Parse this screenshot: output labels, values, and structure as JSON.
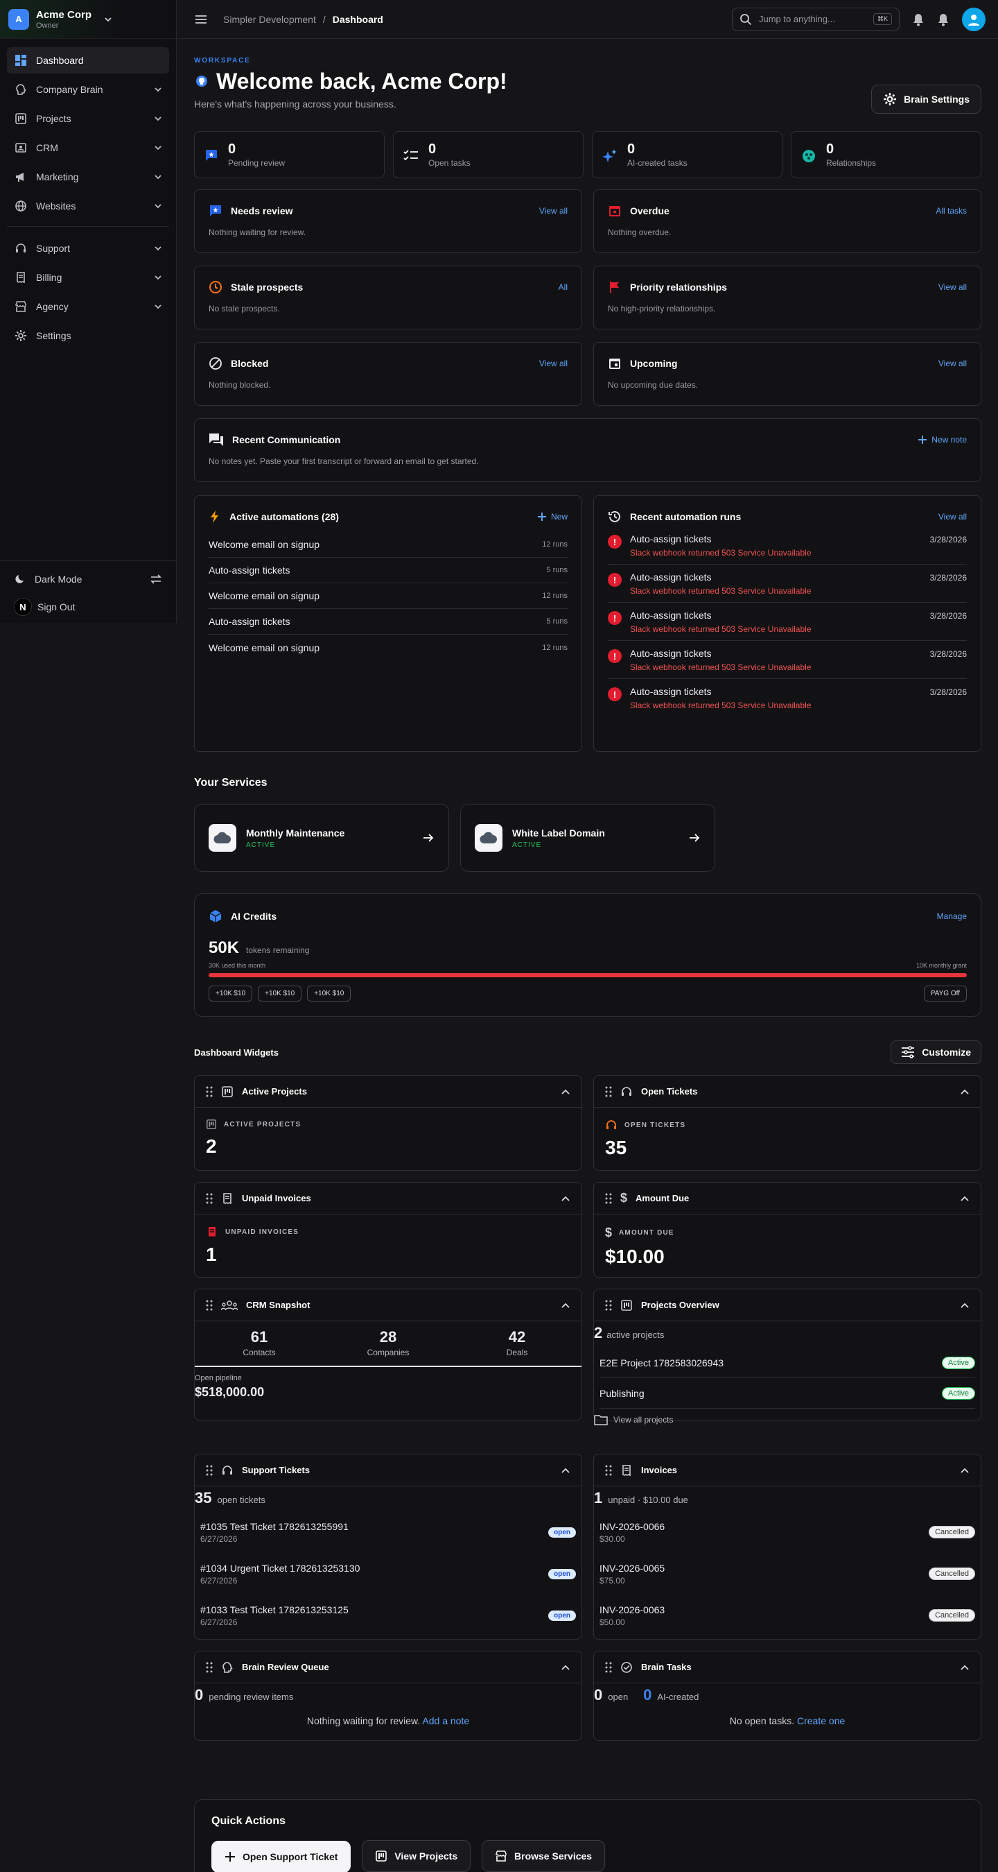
{
  "org": {
    "initial": "A",
    "name": "Acme Corp",
    "role": "Owner"
  },
  "nav": {
    "dashboard": "Dashboard",
    "company_brain": "Company Brain",
    "projects": "Projects",
    "crm": "CRM",
    "marketing": "Marketing",
    "websites": "Websites",
    "support": "Support",
    "billing": "Billing",
    "agency": "Agency",
    "settings": "Settings"
  },
  "sidebar_bottom": {
    "dark_mode": "Dark Mode",
    "sign_out": "Sign Out",
    "n_badge": "N"
  },
  "topbar": {
    "crumb_parent": "Simpler Development",
    "crumb_sep": "/",
    "crumb_current": "Dashboard",
    "search_placeholder": "Jump to anything...",
    "search_kbd": "⌘K"
  },
  "header": {
    "eyebrow": "WORKSPACE",
    "title": "Welcome back, Acme Corp!",
    "subtitle": "Here's what's happening across your business.",
    "brain_settings": "Brain Settings"
  },
  "stats": [
    {
      "num": "0",
      "label": "Pending review"
    },
    {
      "num": "0",
      "label": "Open tasks"
    },
    {
      "num": "0",
      "label": "AI-created tasks"
    },
    {
      "num": "0",
      "label": "Relationships"
    }
  ],
  "panels": {
    "needs_review": {
      "title": "Needs review",
      "link": "View all",
      "empty": "Nothing waiting for review."
    },
    "overdue": {
      "title": "Overdue",
      "link": "All tasks",
      "empty": "Nothing overdue."
    },
    "stale": {
      "title": "Stale prospects",
      "link": "All",
      "empty": "No stale prospects."
    },
    "priority": {
      "title": "Priority relationships",
      "link": "View all",
      "empty": "No high-priority relationships."
    },
    "blocked": {
      "title": "Blocked",
      "link": "View all",
      "empty": "Nothing blocked."
    },
    "upcoming": {
      "title": "Upcoming",
      "link": "View all",
      "empty": "No upcoming due dates."
    },
    "recent_comm": {
      "title": "Recent Communication",
      "link": "New note",
      "empty": "No notes yet. Paste your first transcript or forward an email to get started."
    }
  },
  "automations": {
    "title": "Active automations (28)",
    "new": "New",
    "items": [
      {
        "name": "Welcome email on signup",
        "runs": "12 runs"
      },
      {
        "name": "Auto-assign tickets",
        "runs": "5 runs"
      },
      {
        "name": "Welcome email on signup",
        "runs": "12 runs"
      },
      {
        "name": "Auto-assign tickets",
        "runs": "5 runs"
      },
      {
        "name": "Welcome email on signup",
        "runs": "12 runs"
      }
    ]
  },
  "runs": {
    "title": "Recent automation runs",
    "link": "View all",
    "items": [
      {
        "name": "Auto-assign tickets",
        "error": "Slack webhook returned 503 Service Unavailable",
        "date": "3/28/2026"
      },
      {
        "name": "Auto-assign tickets",
        "error": "Slack webhook returned 503 Service Unavailable",
        "date": "3/28/2026"
      },
      {
        "name": "Auto-assign tickets",
        "error": "Slack webhook returned 503 Service Unavailable",
        "date": "3/28/2026"
      },
      {
        "name": "Auto-assign tickets",
        "error": "Slack webhook returned 503 Service Unavailable",
        "date": "3/28/2026"
      },
      {
        "name": "Auto-assign tickets",
        "error": "Slack webhook returned 503 Service Unavailable",
        "date": "3/28/2026"
      }
    ]
  },
  "services": {
    "title": "Your Services",
    "items": [
      {
        "name": "Monthly Maintenance",
        "status": "ACTIVE"
      },
      {
        "name": "White Label Domain",
        "status": "ACTIVE"
      }
    ]
  },
  "credits": {
    "title": "AI Credits",
    "manage": "Manage",
    "big": "50K",
    "big_label": "tokens remaining",
    "used": "30K used this month",
    "grant": "10K monthly grant",
    "used_fraction": 1.0,
    "buttons": [
      "+10K $10",
      "+10K $10",
      "+10K $10"
    ],
    "payg": "PAYG Off"
  },
  "widgets": {
    "title": "Dashboard Widgets",
    "customize": "Customize",
    "active_projects": {
      "title": "Active Projects",
      "label": "ACTIVE PROJECTS",
      "value": "2"
    },
    "open_tickets": {
      "title": "Open Tickets",
      "label": "OPEN TICKETS",
      "value": "35"
    },
    "unpaid_invoices": {
      "title": "Unpaid Invoices",
      "label": "UNPAID INVOICES",
      "value": "1"
    },
    "amount_due": {
      "title": "Amount Due",
      "label": "AMOUNT DUE",
      "value": "$10.00"
    },
    "crm": {
      "title": "CRM Snapshot",
      "contacts": "61",
      "contacts_label": "Contacts",
      "companies": "28",
      "companies_label": "Companies",
      "deals": "42",
      "deals_label": "Deals",
      "pipeline_label": "Open pipeline",
      "pipeline": "$518,000.00"
    },
    "projects_overview": {
      "title": "Projects Overview",
      "count": "2",
      "count_label": "active projects",
      "items": [
        {
          "name": "E2E Project 1782583026943",
          "status": "Active"
        },
        {
          "name": "Publishing",
          "status": "Active"
        }
      ],
      "view_all": "View all projects"
    },
    "support": {
      "title": "Support Tickets",
      "count": "35",
      "count_label": "open tickets",
      "items": [
        {
          "name": "#1035 Test Ticket 1782613255991",
          "date": "6/27/2026",
          "status": "open"
        },
        {
          "name": "#1034 Urgent Ticket 1782613253130",
          "date": "6/27/2026",
          "status": "open"
        },
        {
          "name": "#1033 Test Ticket 1782613253125",
          "date": "6/27/2026",
          "status": "open"
        }
      ]
    },
    "invoices": {
      "title": "Invoices",
      "count": "1",
      "count_label": "unpaid · $10.00 due",
      "items": [
        {
          "name": "INV-2026-0066",
          "amount": "$30.00",
          "status": "Cancelled"
        },
        {
          "name": "INV-2026-0065",
          "amount": "$75.00",
          "status": "Cancelled"
        },
        {
          "name": "INV-2026-0063",
          "amount": "$50.00",
          "status": "Cancelled"
        }
      ]
    },
    "brain_review": {
      "title": "Brain Review Queue",
      "count": "0",
      "count_label": "pending review items",
      "empty": "Nothing waiting for review.",
      "link": "Add a note"
    },
    "brain_tasks": {
      "title": "Brain Tasks",
      "open": "0",
      "open_label": "open",
      "ai": "0",
      "ai_label": "AI-created",
      "empty": "No open tasks.",
      "link": "Create one"
    }
  },
  "quick_actions": {
    "title": "Quick Actions",
    "support": "Open Support Ticket",
    "projects": "View Projects",
    "services": "Browse Services"
  },
  "colors": {
    "accent": "#3b82f6",
    "error": "#e11d2f",
    "success": "#22c55e"
  }
}
